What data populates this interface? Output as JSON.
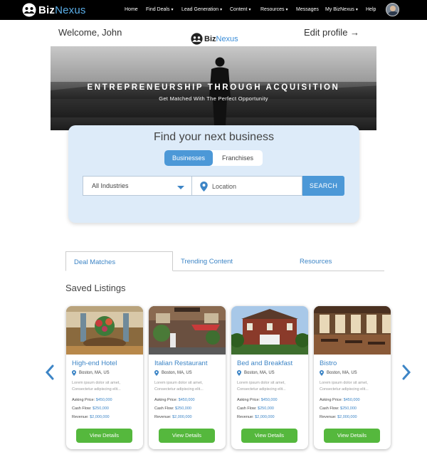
{
  "nav": {
    "brand": {
      "part1": "Biz",
      "part2": "Nexus"
    },
    "links": [
      {
        "label": "Home",
        "dropdown": false
      },
      {
        "label": "Find Deals",
        "dropdown": true
      },
      {
        "label": "Lead Generation",
        "dropdown": true
      },
      {
        "label": "Content",
        "dropdown": true
      },
      {
        "label": "Resources",
        "dropdown": true
      },
      {
        "label": "Messages",
        "dropdown": false
      },
      {
        "label": "My BizNexus",
        "dropdown": true
      },
      {
        "label": "Help",
        "dropdown": false
      }
    ],
    "caret": "▾"
  },
  "welcome": {
    "greeting": "Welcome, John",
    "edit_profile": "Edit profile →"
  },
  "hero": {
    "title": "ENTREPRENEURSHIP THROUGH ACQUISITION",
    "subtitle": "Get Matched With The Perfect Opportunity"
  },
  "search": {
    "title": "Find your next business",
    "toggle": {
      "businesses": "Businesses",
      "franchises": "Franchises"
    },
    "industry_value": "All Industries",
    "location_placeholder": "Location",
    "button": "SEARCH"
  },
  "tabs": [
    "Deal Matches",
    "Trending Content",
    "Resources"
  ],
  "saved_title": "Saved Listings",
  "listings": [
    {
      "name": "High-end Hotel",
      "location": "Boston, MA, US",
      "desc1": "Lorem ipsum dolor sit amet,",
      "desc2": "Consectetur adipiscing elit...",
      "asking_label": "Asking Price:",
      "asking": "$450,000",
      "cashflow_label": "Cash Flow:",
      "cashflow": "$250,000",
      "revenue_label": "Revenue:",
      "revenue": "$2,000,000",
      "button": "View Details"
    },
    {
      "name": "Italian Restaurant",
      "location": "Boston, MA, US",
      "desc1": "Lorem ipsum dolor sit amet,",
      "desc2": "Consectetur adipiscing elit...",
      "asking_label": "Asking Price:",
      "asking": "$450,000",
      "cashflow_label": "Cash Flow:",
      "cashflow": "$250,000",
      "revenue_label": "Revenue:",
      "revenue": "$2,000,000",
      "button": "View Details"
    },
    {
      "name": "Bed and Breakfast",
      "location": "Boston, MA, US",
      "desc1": "Lorem ipsum dolor sit amet,",
      "desc2": "Consectetur adipiscing elit...",
      "asking_label": "Asking Price:",
      "asking": "$450,000",
      "cashflow_label": "Cash Flow:",
      "cashflow": "$250,000",
      "revenue_label": "Revenue:",
      "revenue": "$2,000,000",
      "button": "View Details"
    },
    {
      "name": "Bistro",
      "location": "Boston, MA, US",
      "desc1": "Lorem ipsum dolor sit amet,",
      "desc2": "Consectetur adipiscing elit...",
      "asking_label": "Asking Price:",
      "asking": "$450,000",
      "cashflow_label": "Cash Flow:",
      "cashflow": "$250,000",
      "revenue_label": "Revenue:",
      "revenue": "$2,000,000",
      "button": "View Details"
    }
  ],
  "icons": {
    "prev": "chevron-left-icon",
    "next": "chevron-right-icon",
    "pin": "map-pin-icon"
  },
  "colors": {
    "accent_blue": "#4c98d7",
    "link_blue": "#3d85c6",
    "button_green": "#55b83d",
    "search_bg": "#ddebf9",
    "nav_bg": "#000000"
  }
}
